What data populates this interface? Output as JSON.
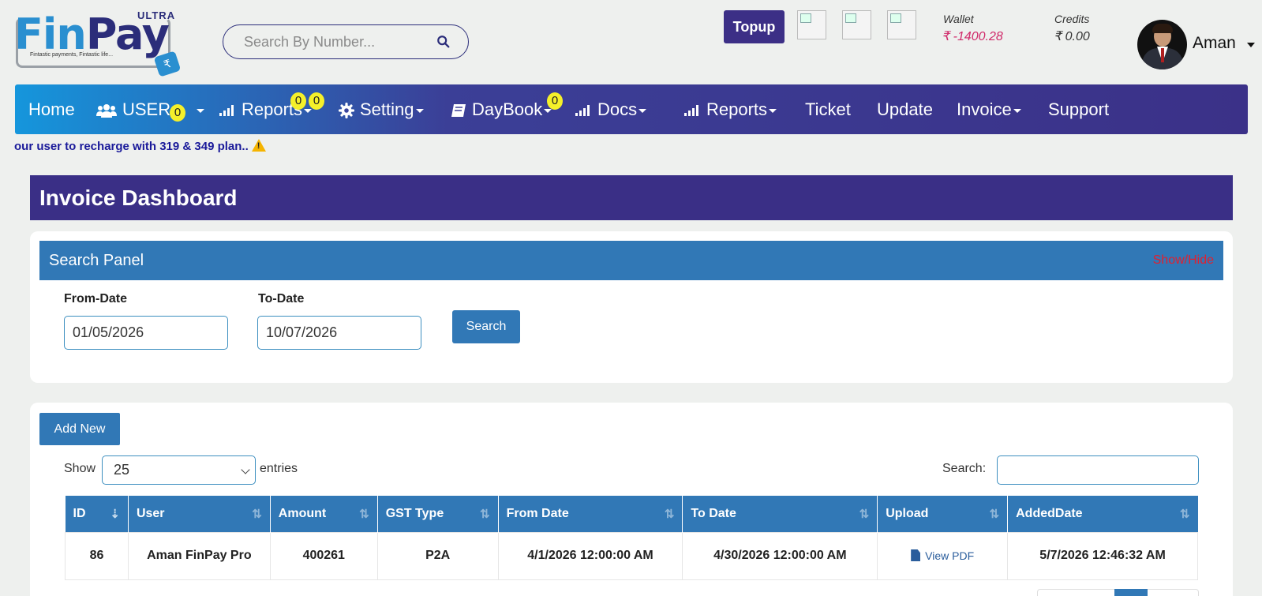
{
  "brand": {
    "logo_fin": "Fin",
    "logo_pay": "Pay",
    "logo_ultra": "ULTRA",
    "tagline": "Fintastic payments, Fintastic life..."
  },
  "header": {
    "search_placeholder": "Search By Number...",
    "topup_label": "Topup",
    "wallet_label": "Wallet",
    "wallet_value": "₹ -1400.28",
    "credits_label": "Credits",
    "credits_value": "₹ 0.00",
    "user_name": "Aman"
  },
  "nav": {
    "home": "Home",
    "users": "USERs",
    "users_badge": "0",
    "reports": "Reports",
    "reports_badge1": "0",
    "reports_badge2": "0",
    "setting": "Setting",
    "daybook": "DayBook",
    "daybook_badge": "0",
    "docs": "Docs",
    "reports2": "Reports",
    "ticket": "Ticket",
    "update": "Update",
    "invoice": "Invoice",
    "support": "Support"
  },
  "ticker": "our user to recharge with 319 & 349 plan..",
  "page": {
    "title": "Invoice Dashboard"
  },
  "search_panel": {
    "title": "Search Panel",
    "toggle": "Show/Hide",
    "from_label": "From-Date",
    "from_value": "01/05/2026",
    "to_label": "To-Date",
    "to_value": "10/07/2026",
    "search_button": "Search"
  },
  "table_controls": {
    "add_new": "Add New",
    "show_label": "Show",
    "entries_value": "25",
    "entries_label": "entries",
    "search_label": "Search:"
  },
  "table": {
    "columns": [
      "ID",
      "User",
      "Amount",
      "GST Type",
      "From Date",
      "To Date",
      "Upload",
      "AddedDate"
    ],
    "rows": [
      {
        "id": "86",
        "user": "Aman FinPay Pro",
        "amount": "400261",
        "gst_type": "P2A",
        "from_date": "4/1/2026 12:00:00 AM",
        "to_date": "4/30/2026 12:00:00 AM",
        "upload": "View PDF",
        "added_date": "5/7/2026 12:46:32 AM"
      }
    ]
  },
  "colors": {
    "primary": "#3178b6",
    "nav_dark": "#3b3188",
    "nav_light": "#1596dc",
    "title_bar": "#3a2f86",
    "wallet_negative": "#d02a6a",
    "toggle_red": "#e02030",
    "badge_yellow": "#f5f02a"
  }
}
